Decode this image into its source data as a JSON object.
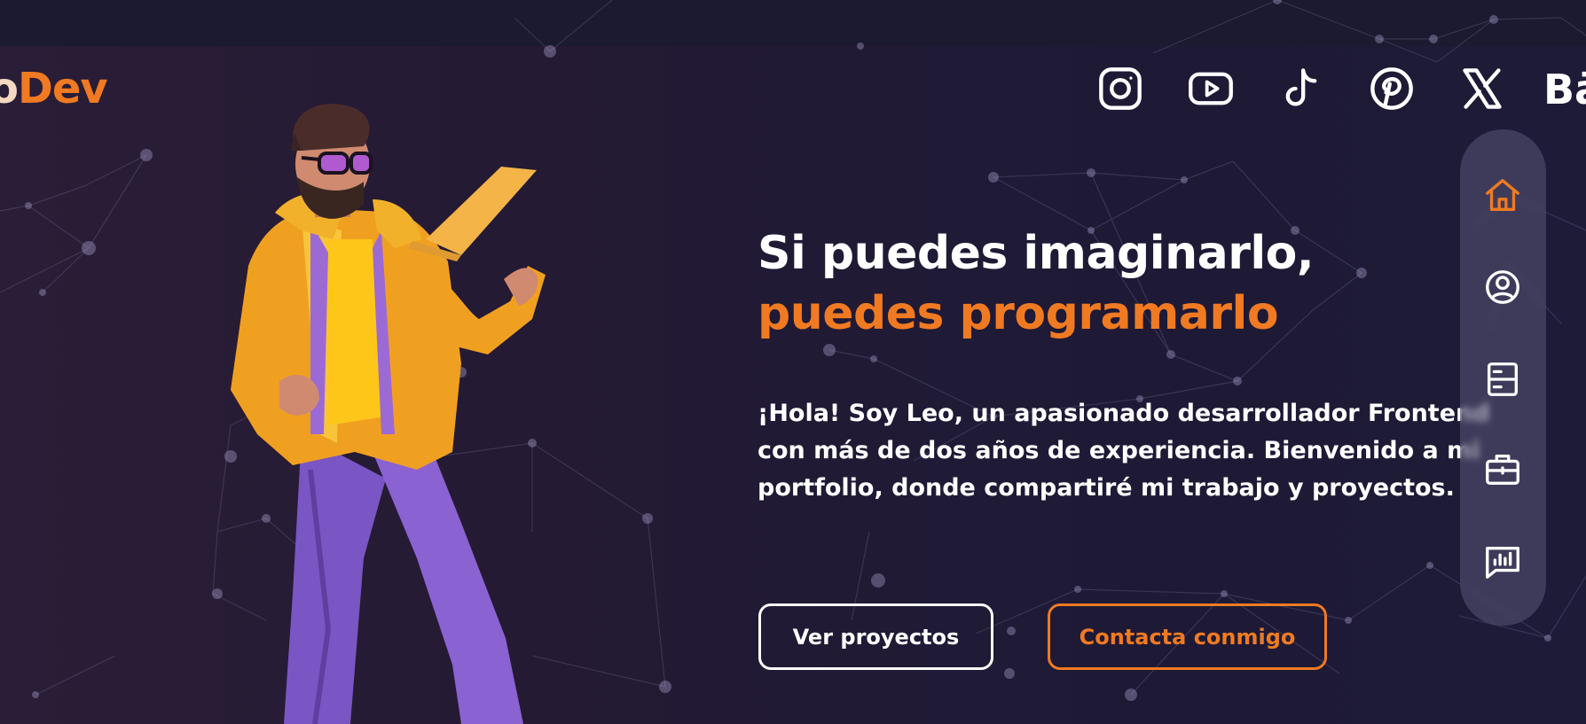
{
  "logo": {
    "prefix": "o",
    "accent": "Dev"
  },
  "social": [
    "instagram-icon",
    "youtube-icon",
    "tiktok-icon",
    "pinterest-icon",
    "x-icon"
  ],
  "header_partial_text": "Bä",
  "hero": {
    "title_line1": "Si puedes imaginarlo,",
    "title_line2": "puedes programarlo",
    "intro_line1": "¡Hola! Soy Leo, un apasionado desarrollador Frontend",
    "intro_line2": "con más de dos años de experiencia. Bienvenido a mi",
    "intro_line3": "portfolio, donde compartiré mi trabajo y proyectos."
  },
  "buttons": {
    "projects": "Ver proyectos",
    "contact": "Contacta conmigo"
  },
  "sidenav": [
    "home-icon",
    "profile-icon",
    "resume-icon",
    "briefcase-icon",
    "stats-icon"
  ],
  "colors": {
    "accent": "#f07a22",
    "background": "#1d1a32",
    "text": "#ffffff"
  }
}
